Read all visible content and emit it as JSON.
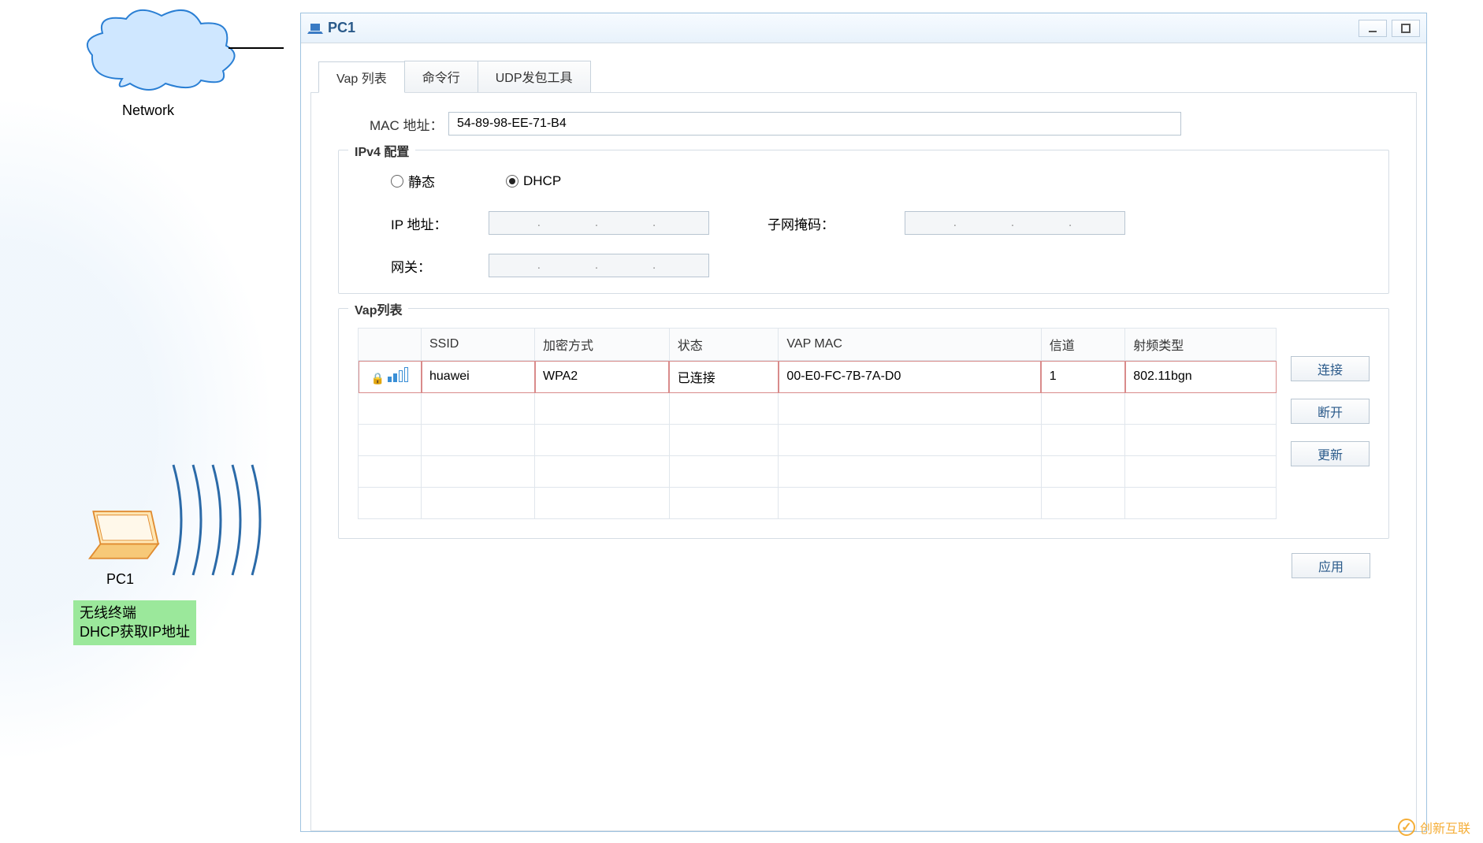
{
  "topology": {
    "network_label": "Network",
    "pc_label": "PC1",
    "note_line1": "无线终端",
    "note_line2": "DHCP获取IP地址"
  },
  "window": {
    "title": "PC1",
    "tabs": [
      {
        "label": "Vap 列表",
        "active": true
      },
      {
        "label": "命令行",
        "active": false
      },
      {
        "label": "UDP发包工具",
        "active": false
      }
    ]
  },
  "mac": {
    "label": "MAC 地址：",
    "value": "54-89-98-EE-71-B4"
  },
  "ipv4": {
    "legend": "IPv4 配置",
    "static_label": "静态",
    "dhcp_label": "DHCP",
    "selected": "dhcp",
    "ip_label": "IP 地址：",
    "ip_value": ".      .      .",
    "mask_label": "子网掩码：",
    "mask_value": ".      .      .",
    "gw_label": "网关：",
    "gw_value": ".      .      ."
  },
  "vap": {
    "legend": "Vap列表",
    "headers": {
      "ssid": "SSID",
      "enc": "加密方式",
      "status": "状态",
      "vapmac": "VAP MAC",
      "channel": "信道",
      "radio": "射频类型"
    },
    "rows": [
      {
        "ssid": "huawei",
        "enc": "WPA2",
        "status": "已连接",
        "vapmac": "00-E0-FC-7B-7A-D0",
        "channel": "1",
        "radio": "802.11bgn",
        "locked": true,
        "selected": true
      }
    ],
    "empty_rows": 4
  },
  "buttons": {
    "connect": "连接",
    "disconnect": "断开",
    "refresh": "更新",
    "apply": "应用"
  },
  "watermark": "创新互联"
}
